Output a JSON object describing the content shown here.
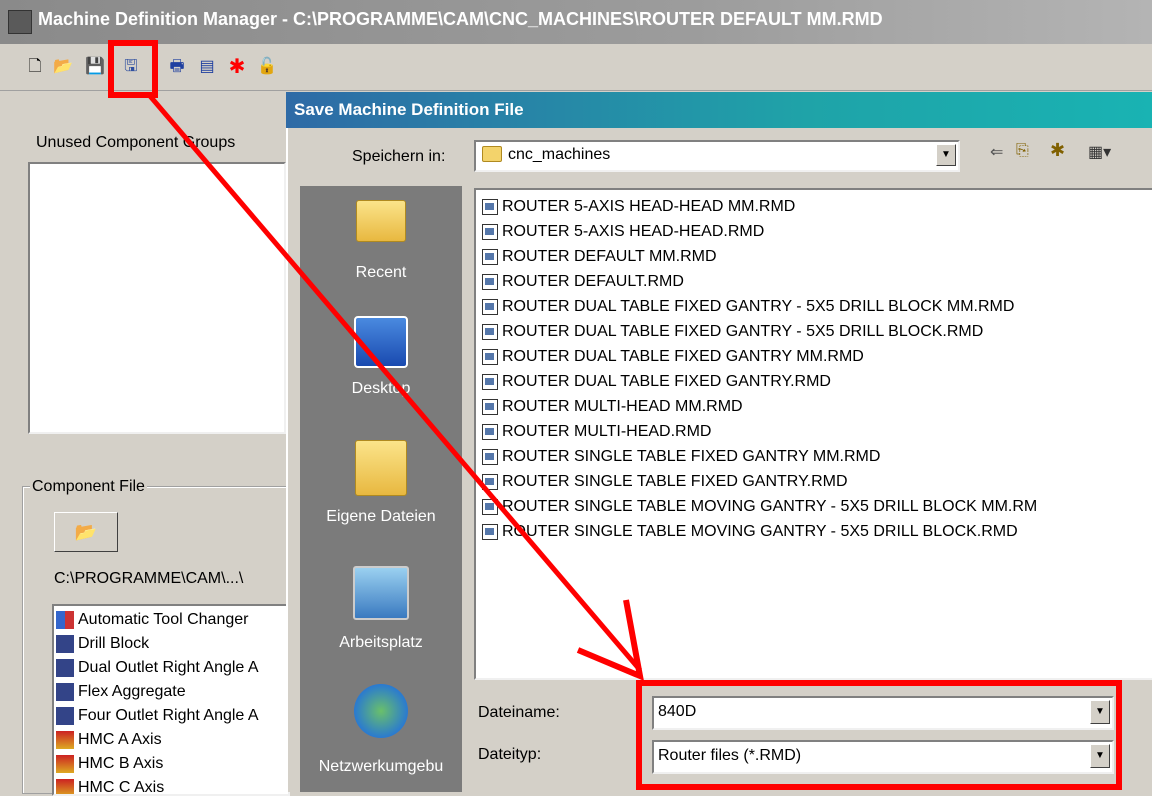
{
  "window": {
    "title": "Machine Definition Manager - C:\\PROGRAMME\\CAM\\CNC_MACHINES\\ROUTER DEFAULT MM.RMD"
  },
  "toolbar": {
    "icons": [
      "new-file-icon",
      "open-file-icon",
      "save-icon",
      "save-as-icon",
      "print-icon",
      "disk-icon",
      "asterisk-icon",
      "unlock-icon"
    ],
    "glyphs": [
      "🗋",
      "📂",
      "💾",
      "🖫",
      "🖶",
      "▤",
      "✱",
      "🔓"
    ]
  },
  "left_panel": {
    "unused_groups_label": "Unused Component Groups",
    "component_file_label": "Component File",
    "open_button_glyph": "📂",
    "path": "C:\\PROGRAMME\\CAM\\...\\",
    "components": [
      "Automatic Tool Changer",
      "Drill Block",
      "Dual Outlet Right Angle A",
      "Flex Aggregate",
      "Four Outlet Right Angle A",
      "HMC A Axis",
      "HMC B Axis",
      "HMC C Axis"
    ]
  },
  "dialog": {
    "title": "Save Machine Definition File",
    "save_in_label": "Speichern in:",
    "save_in_value": "cnc_machines",
    "nav_glyphs": {
      "back": "⇐",
      "up": "⎘",
      "new_folder": "✱",
      "view": "▦▾"
    },
    "places": [
      {
        "label": "Recent",
        "icon": "folder-icon"
      },
      {
        "label": "Desktop",
        "icon": "desktop-icon"
      },
      {
        "label": "Eigene Dateien",
        "icon": "documents-folder-icon"
      },
      {
        "label": "Arbeitsplatz",
        "icon": "computer-icon"
      },
      {
        "label": "Netzwerkumgebu",
        "icon": "network-icon"
      }
    ],
    "files": [
      "ROUTER 5-AXIS HEAD-HEAD MM.RMD",
      "ROUTER 5-AXIS HEAD-HEAD.RMD",
      "ROUTER DEFAULT MM.RMD",
      "ROUTER DEFAULT.RMD",
      "ROUTER DUAL TABLE FIXED GANTRY - 5X5 DRILL BLOCK MM.RMD",
      "ROUTER DUAL TABLE FIXED GANTRY - 5X5 DRILL BLOCK.RMD",
      "ROUTER DUAL TABLE FIXED GANTRY MM.RMD",
      "ROUTER DUAL TABLE FIXED GANTRY.RMD",
      "ROUTER MULTI-HEAD MM.RMD",
      "ROUTER MULTI-HEAD.RMD",
      "ROUTER SINGLE TABLE FIXED GANTRY MM.RMD",
      "ROUTER SINGLE TABLE FIXED GANTRY.RMD",
      "ROUTER SINGLE TABLE MOVING GANTRY - 5X5 DRILL BLOCK MM.RM",
      "ROUTER SINGLE TABLE MOVING GANTRY - 5X5 DRILL BLOCK.RMD"
    ],
    "filename_label": "Dateiname:",
    "filename_value": "840D",
    "filetype_label": "Dateityp:",
    "filetype_value": "Router files (*.RMD)"
  },
  "annotation": {
    "color": "#ff0000"
  }
}
